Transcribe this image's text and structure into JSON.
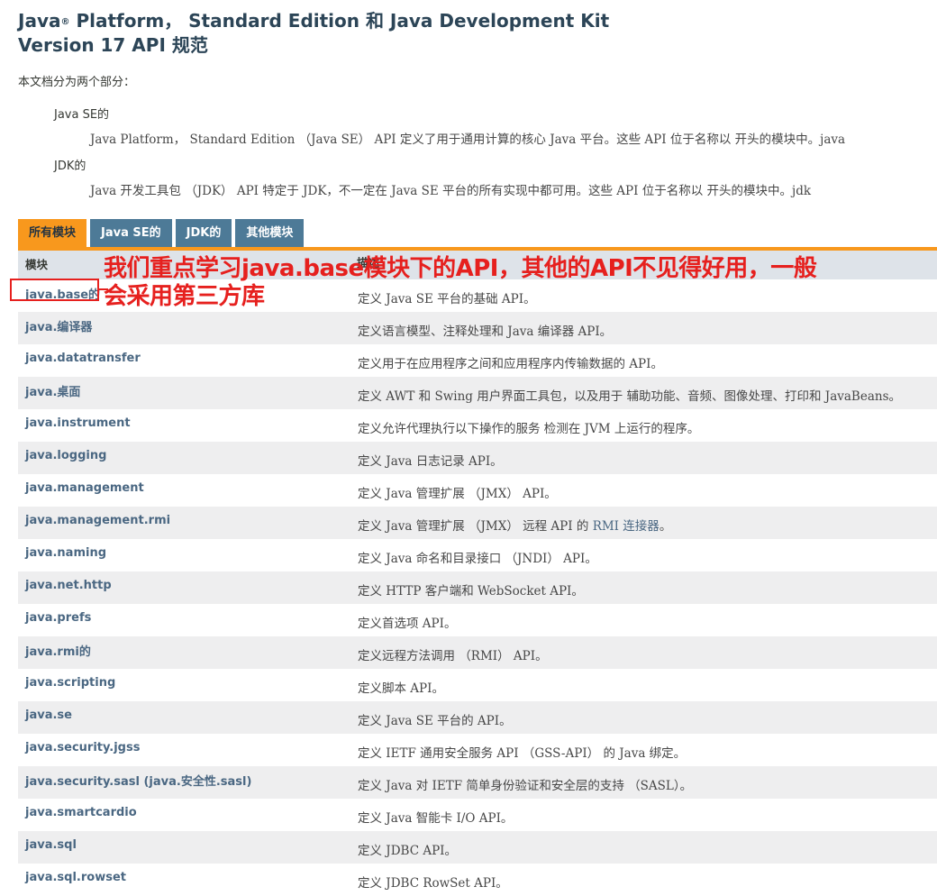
{
  "title": {
    "line1_prefix": "Java",
    "reg": "®",
    "line1_rest": " Platform， Standard Edition 和 Java Development Kit",
    "line2": "Version 17 API 规范"
  },
  "intro": "本文档分为两个部分：",
  "sections": [
    {
      "term": "Java SE的",
      "description": "Java Platform， Standard Edition （Java SE） API 定义了用于通用计算的核心 Java 平台。这些 API 位于名称以 开头的模块中。java"
    },
    {
      "term": "JDK的",
      "description": "Java 开发工具包 （JDK） API 特定于 JDK，不一定在 Java SE 平台的所有实现中都可用。这些 API 位于名称以 开头的模块中。jdk"
    }
  ],
  "tabs": [
    "所有模块",
    "Java SE的",
    "JDK的",
    "其他模块"
  ],
  "table": {
    "headers": [
      "模块",
      "描述"
    ],
    "rows": [
      {
        "module": "java.base的",
        "description": "定义 Java SE 平台的基础 API。"
      },
      {
        "module": "java.编译器",
        "description": "定义语言模型、注释处理和 Java 编译器 API。"
      },
      {
        "module": "java.datatransfer",
        "description": "定义用于在应用程序之间和应用程序内传输数据的 API。"
      },
      {
        "module": "java.桌面",
        "description": "定义 AWT 和 Swing 用户界面工具包，以及用于 辅助功能、音频、图像处理、打印和 JavaBeans。"
      },
      {
        "module": "java.instrument",
        "description": "定义允许代理执行以下操作的服务 检测在 JVM 上运行的程序。"
      },
      {
        "module": "java.logging",
        "description": "定义 Java 日志记录 API。"
      },
      {
        "module": "java.management",
        "description": "定义 Java 管理扩展 （JMX） API。"
      },
      {
        "module": "java.management.rmi",
        "description": "定义 Java 管理扩展 （JMX） 远程 API 的 ",
        "link": "RMI 连接器",
        "suffix": "。"
      },
      {
        "module": "java.naming",
        "description": "定义 Java 命名和目录接口 （JNDI） API。"
      },
      {
        "module": "java.net.http",
        "description": "定义 HTTP 客户端和 WebSocket API。"
      },
      {
        "module": "java.prefs",
        "description": "定义首选项 API。"
      },
      {
        "module": "java.rmi的",
        "description": "定义远程方法调用 （RMI） API。"
      },
      {
        "module": "java.scripting",
        "description": "定义脚本 API。"
      },
      {
        "module": "java.se",
        "description": "定义 Java SE 平台的 API。"
      },
      {
        "module": "java.security.jgss",
        "description": "定义 IETF 通用安全服务 API （GSS-API） 的 Java 绑定。"
      },
      {
        "module": "java.security.sasl (java.安全性.sasl)",
        "description": "定义 Java 对 IETF 简单身份验证和安全层的支持 （SASL）。"
      },
      {
        "module": "java.smartcardio",
        "description": "定义 Java 智能卡 I/O API。"
      },
      {
        "module": "java.sql",
        "description": "定义 JDBC API。"
      },
      {
        "module": "java.sql.rowset",
        "description": "定义 JDBC RowSet API。"
      }
    ]
  },
  "annotation": {
    "line1": "我们重点学习java.base模块下的API，其他的API不见得好用，一般",
    "line2": "会采用第三方库",
    "color": "#e6201e"
  },
  "colors": {
    "title": "#2c4557",
    "tab_active": "#f8981d",
    "tab_inactive": "#4d7a97",
    "header_bg": "#dee3e9",
    "row_alt": "#eeeeef",
    "link": "#4a6782"
  }
}
